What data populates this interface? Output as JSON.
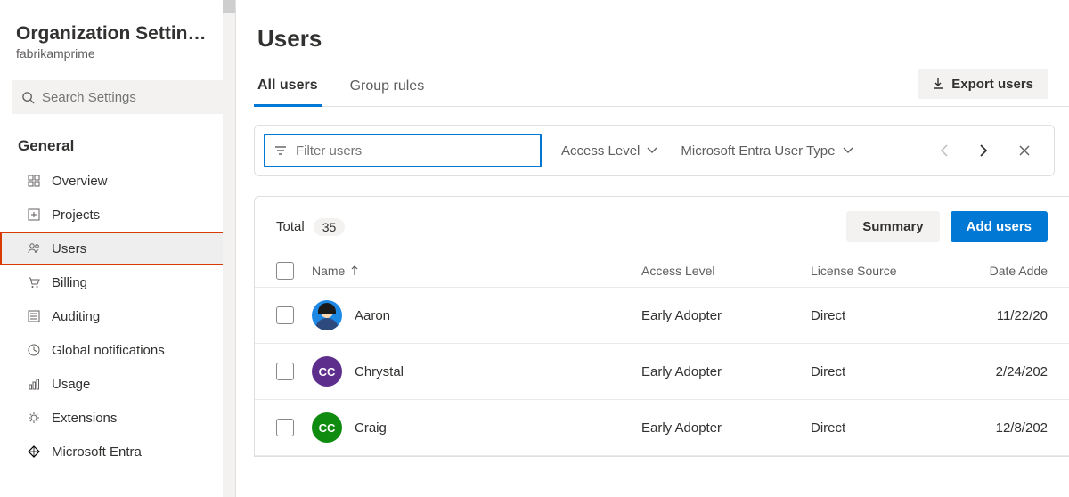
{
  "sidebar": {
    "title": "Organization Settin…",
    "subtitle": "fabrikamprime",
    "search_placeholder": "Search Settings",
    "section_label": "General",
    "items": [
      {
        "label": "Overview",
        "icon": "grid-icon"
      },
      {
        "label": "Projects",
        "icon": "plus-box-icon"
      },
      {
        "label": "Users",
        "icon": "people-icon",
        "active": true,
        "highlight": true
      },
      {
        "label": "Billing",
        "icon": "cart-icon"
      },
      {
        "label": "Auditing",
        "icon": "list-icon"
      },
      {
        "label": "Global notifications",
        "icon": "clock-icon"
      },
      {
        "label": "Usage",
        "icon": "chart-icon"
      },
      {
        "label": "Extensions",
        "icon": "gear-icon"
      },
      {
        "label": "Microsoft Entra",
        "icon": "diamond-icon"
      }
    ]
  },
  "main": {
    "title": "Users",
    "tabs": {
      "all_users": "All users",
      "group_rules": "Group rules"
    },
    "export_label": "Export users",
    "filter": {
      "placeholder": "Filter users",
      "access_level_label": "Access Level",
      "entra_label": "Microsoft Entra User Type"
    },
    "total_label": "Total",
    "total_count": "35",
    "summary_label": "Summary",
    "add_users_label": "Add users",
    "columns": {
      "name": "Name",
      "access": "Access Level",
      "license": "License Source",
      "date": "Date Adde"
    },
    "rows": [
      {
        "name": "Aaron",
        "access": "Early Adopter",
        "license": "Direct",
        "date": "11/22/20",
        "avatar_bg": "image",
        "avatar_initials": ""
      },
      {
        "name": "Chrystal",
        "access": "Early Adopter",
        "license": "Direct",
        "date": "2/24/202",
        "avatar_bg": "#5d2e8c",
        "avatar_initials": "CC"
      },
      {
        "name": "Craig",
        "access": "Early Adopter",
        "license": "Direct",
        "date": "12/8/202",
        "avatar_bg": "#0f8b0f",
        "avatar_initials": "CC"
      }
    ]
  }
}
